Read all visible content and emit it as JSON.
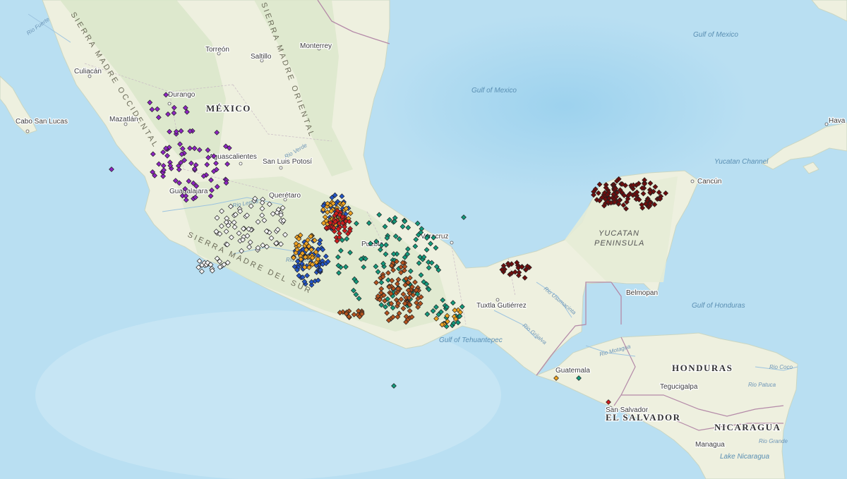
{
  "map": {
    "countries": [
      "MÉXICO",
      "HONDURAS",
      "EL SALVADOR",
      "NICARAGUA"
    ],
    "cities": [
      "Torreón",
      "Saltillo",
      "Monterrey",
      "Culiacán",
      "Durango",
      "Mazatlán",
      "Cabo San Lucas",
      "Aguascalientes",
      "San Luis Potosí",
      "Guadalajara",
      "Querétaro",
      "Veracruz",
      "Puebla",
      "Tuxtla Gutiérrez",
      "Cancún",
      "Belmopan",
      "Guatemala",
      "Tegucigalpa",
      "San Salvador",
      "Managua",
      "Hava"
    ],
    "water": [
      "Gulf of Mexico",
      "Gulf of Mexico",
      "Gulf of Tehuantepec",
      "Yucatan Channel",
      "Gulf of Honduras",
      "Lake Nicaragua"
    ],
    "physical": [
      "SIERRA MADRE OCCIDENTAL",
      "SIERRA MADRE ORIENTAL",
      "SIERRA MADRE DEL SUR",
      "YUCATAN PENINSULA"
    ],
    "rivers": [
      "Rio Fuerte",
      "Rio Verde",
      "Rio Lerma",
      "Rio Balsas",
      "Rio Grijalva",
      "Rio Usumacinta",
      "Rio Motagua",
      "Rio Coco",
      "Rio Patuca",
      "Rio Grande"
    ],
    "marker_colors": {
      "purple": "#8e24c2",
      "white": "#f4f4f4",
      "blue": "#2356c8",
      "orange": "#f0a322",
      "red": "#d01d1d",
      "teal": "#139a7c",
      "brown": "#b5531e",
      "maroon": "#6e0d0d"
    },
    "colors": {
      "water": "#b9dff2",
      "land": "#eef0df",
      "highland": "#d8e6c8",
      "border": "#b48aa8"
    }
  }
}
